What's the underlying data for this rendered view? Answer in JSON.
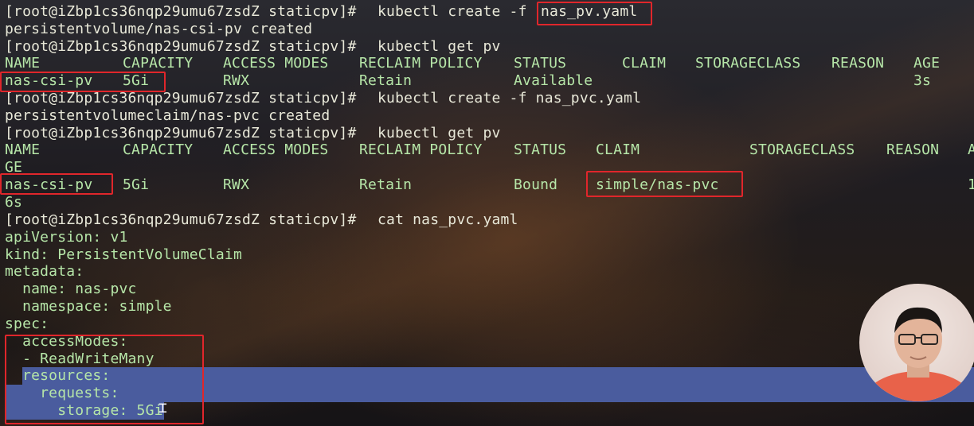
{
  "terminal": {
    "lines": [
      {
        "prompt": "[root@iZbp1cs36nqp29umu67zsdZ staticpv]#",
        "command": "kubectl create -f",
        "arg": "nas_pv.yaml"
      },
      {
        "text": "persistentvolume/nas-csi-pv created"
      },
      {
        "prompt": "[root@iZbp1cs36nqp29umu67zsdZ staticpv]#",
        "command": "kubectl get pv"
      },
      {
        "cols": [
          "NAME",
          "CAPACITY",
          "ACCESS MODES",
          "RECLAIM POLICY",
          "STATUS",
          "CLAIM",
          "STORAGECLASS",
          "REASON",
          "AGE"
        ]
      },
      {
        "cols": [
          "nas-csi-pv",
          "5Gi",
          "RWX",
          "Retain",
          "Available",
          "",
          "",
          "",
          "3s"
        ]
      },
      {
        "prompt": "[root@iZbp1cs36nqp29umu67zsdZ staticpv]#",
        "command": "kubectl create -f nas_pvc.yaml"
      },
      {
        "text": "persistentvolumeclaim/nas-pvc created"
      },
      {
        "prompt": "[root@iZbp1cs36nqp29umu67zsdZ staticpv]#",
        "command": "kubectl get pv"
      },
      {
        "cols": [
          "NAME",
          "CAPACITY",
          "ACCESS MODES",
          "RECLAIM POLICY",
          "STATUS",
          "CLAIM",
          "STORAGECLASS",
          "REASON",
          "A"
        ]
      },
      {
        "text": "GE"
      },
      {
        "cols": [
          "nas-csi-pv",
          "5Gi",
          "RWX",
          "Retain",
          "Bound",
          "simple/nas-pvc",
          "",
          "",
          "1"
        ]
      },
      {
        "text": "6s"
      },
      {
        "prompt": "[root@iZbp1cs36nqp29umu67zsdZ staticpv]#",
        "command": "cat nas_pvc.yaml"
      },
      {
        "text": "apiVersion: v1"
      },
      {
        "text": "kind: PersistentVolumeClaim"
      },
      {
        "text": "metadata:"
      },
      {
        "text": "  name: nas-pvc"
      },
      {
        "text": "  namespace: simple"
      },
      {
        "text": "spec:"
      },
      {
        "text": "  accessModes:"
      },
      {
        "text": "  - ReadWriteMany"
      },
      {
        "text": "  resources:"
      },
      {
        "text": "    requests:"
      },
      {
        "text": "      storage: 5Gi"
      }
    ]
  },
  "colors": {
    "text": "#e8e8d8",
    "output_green": "#b6e6a8",
    "selection": "#4a5c9e",
    "annotation_box": "#e0262b"
  },
  "webcam": {
    "icon": "presenter-webcam"
  }
}
